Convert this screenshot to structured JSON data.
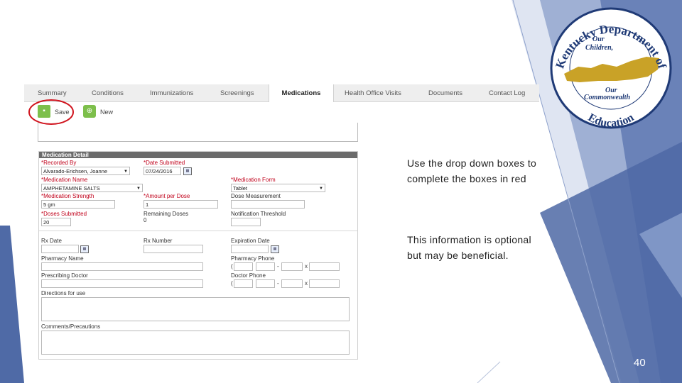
{
  "tabs": [
    {
      "label": "Summary"
    },
    {
      "label": "Conditions"
    },
    {
      "label": "Immunizations"
    },
    {
      "label": "Screenings"
    },
    {
      "label": "Medications"
    },
    {
      "label": "Health Office Visits"
    },
    {
      "label": "Documents"
    },
    {
      "label": "Contact Log"
    }
  ],
  "active_tab": "Medications",
  "toolbar": {
    "save_label": "Save",
    "new_label": "New",
    "save_icon": "floppy-disk-icon",
    "new_icon": "plus-circle-icon"
  },
  "form": {
    "title": "Medication Detail",
    "recorded_by": {
      "label": "*Recorded By",
      "value": "Alvarado-Erichsen, Joanne"
    },
    "date_submitted": {
      "label": "*Date Submitted",
      "value": "07/24/2016"
    },
    "medication_name": {
      "label": "*Medication Name",
      "value": "AMPHETAMINE SALTS"
    },
    "medication_form": {
      "label": "*Medication Form",
      "value": "Tablet"
    },
    "medication_strength": {
      "label": "*Medication Strength",
      "value": "5 gm"
    },
    "amount_per_dose": {
      "label": "*Amount per Dose",
      "value": "1"
    },
    "dose_measurement": {
      "label": "Dose Measurement",
      "value": ""
    },
    "doses_submitted": {
      "label": "*Doses Submitted",
      "value": "20"
    },
    "remaining_doses": {
      "label": "Remaining Doses",
      "value": "0"
    },
    "notification_threshold": {
      "label": "Notification Threshold",
      "value": ""
    },
    "rx_date": {
      "label": "Rx Date",
      "value": ""
    },
    "rx_number": {
      "label": "Rx Number",
      "value": ""
    },
    "expiration_date": {
      "label": "Expiration Date",
      "value": ""
    },
    "pharmacy_name": {
      "label": "Pharmacy Name",
      "value": ""
    },
    "pharmacy_phone": {
      "label": "Pharmacy Phone",
      "paren": "(",
      "dash": "-",
      "x": "x"
    },
    "prescribing_doctor": {
      "label": "Prescribing Doctor",
      "value": ""
    },
    "doctor_phone": {
      "label": "Doctor Phone",
      "paren": "(",
      "dash": "-",
      "x": "x"
    },
    "directions": {
      "label": "Directions for use"
    },
    "comments": {
      "label": "Comments/Precautions"
    }
  },
  "notes": {
    "red_boxes_line1": "Use the drop down boxes to",
    "red_boxes_line2": "complete the boxes in red",
    "optional_line1": "This information is optional",
    "optional_line2": "but may be beneficial."
  },
  "logo": {
    "top_text": "Kentucky Department of",
    "middle_text_1": "Our",
    "middle_text_2": "Children,",
    "middle_text_3": "Our",
    "middle_text_4": "Commonwealth",
    "bottom_text": "Education"
  },
  "page_number": "40",
  "colors": {
    "accent_blue": "#4f6aa6",
    "light_blue": "#b8c5e0",
    "highlight_red": "#d0141e",
    "logo_gold": "#c9a227",
    "logo_navy": "#1f3a76"
  }
}
